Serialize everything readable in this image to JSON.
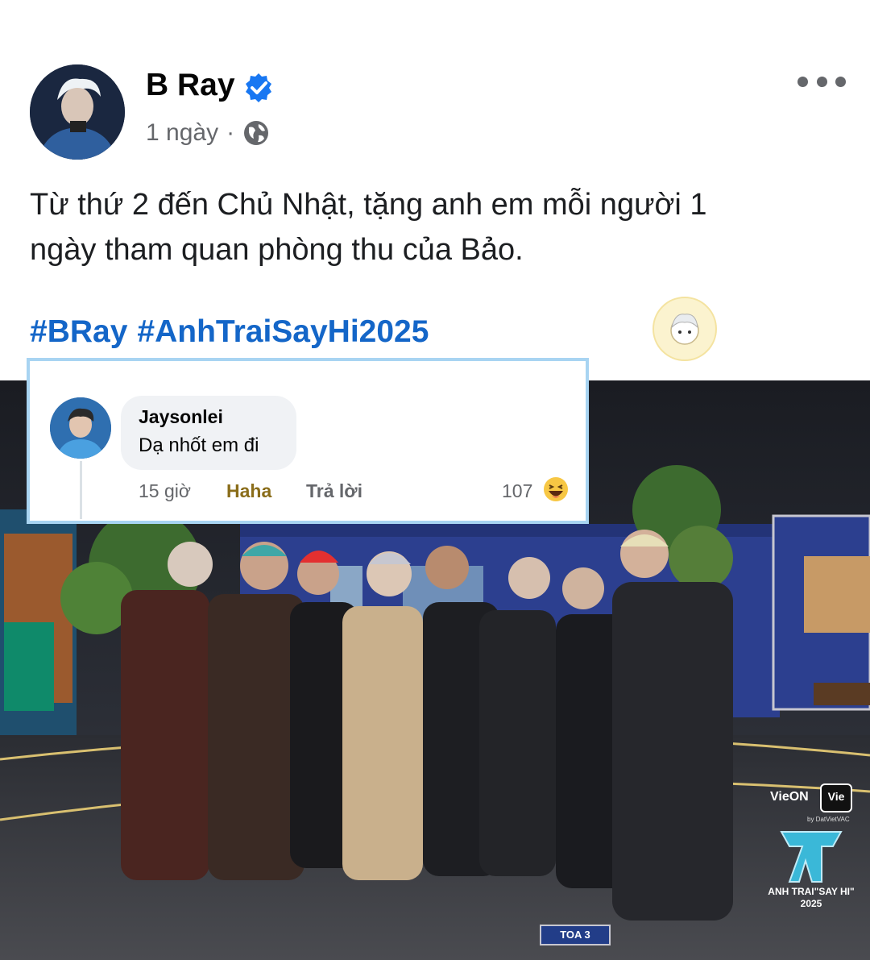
{
  "post": {
    "author": "B Ray",
    "time": "1 ngày",
    "separator": "·",
    "text_line1": "Từ thứ 2 đến Chủ Nhật, tặng anh em mỗi người 1",
    "text_line2": "ngày tham quan phòng thu của Bảo.",
    "hashtags": [
      "#BRay",
      "#AnhTraiSayHi2025"
    ]
  },
  "comment": {
    "author": "Jaysonlei",
    "text": "Dạ nhốt em đi",
    "time": "15 giờ",
    "reaction_label": "Haha",
    "reply_label": "Trả lời",
    "reaction_count": "107"
  },
  "photo_overlay": {
    "broadcaster_logo": "VieON",
    "channel_logo": "Vie",
    "channel_sub": "by DatVietVAC",
    "show_title_line1": "ANH TRAI\"SAY HI\"",
    "show_title_line2": "2025",
    "train_sign": "TOA 3"
  },
  "colors": {
    "hashtag": "#1466c8",
    "verified": "#1877f2",
    "comment_border": "#a8d4f2",
    "haha": "#8a6d1a"
  },
  "icons": [
    "verified-badge-icon",
    "globe-icon",
    "more-options-icon",
    "haha-reaction-icon"
  ]
}
